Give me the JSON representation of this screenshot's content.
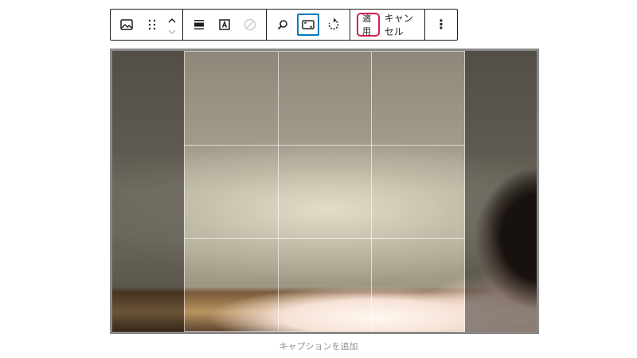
{
  "toolbar": {
    "apply_label": "適用",
    "cancel_label": "キャンセル",
    "more_label": "⋮",
    "icons": [
      "image-icon",
      "drag-handle-icon",
      "move-up-icon",
      "move-down-icon",
      "align-icon",
      "text-over-image-icon",
      "disabled-circle-icon",
      "zoom-icon",
      "aspect-ratio-icon",
      "rotate-icon"
    ]
  },
  "editor": {
    "caption_placeholder": "キャプションを追加"
  }
}
